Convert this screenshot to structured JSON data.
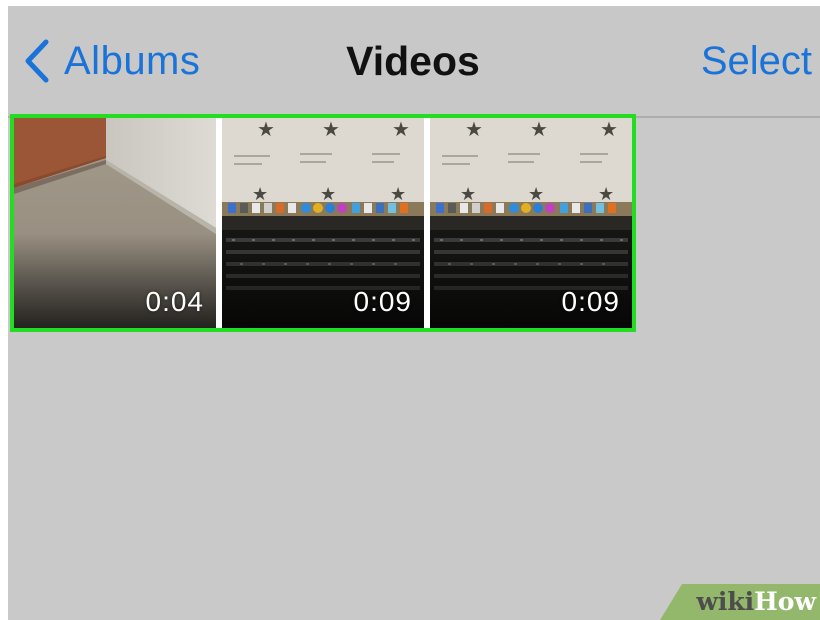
{
  "nav": {
    "back_label": "Albums",
    "title": "Videos",
    "select_label": "Select",
    "back_icon": "chevron-left-icon"
  },
  "videos": [
    {
      "duration": "0:04",
      "thumbnail": "room-floor-corner"
    },
    {
      "duration": "0:09",
      "thumbnail": "laptop-screen-keyboard"
    },
    {
      "duration": "0:09",
      "thumbnail": "laptop-screen-keyboard"
    }
  ],
  "watermark": {
    "part1": "wiki",
    "part2": "How"
  },
  "colors": {
    "accent": "#1a73d9",
    "highlight": "#22dd22",
    "background": "#c9c9c9"
  }
}
